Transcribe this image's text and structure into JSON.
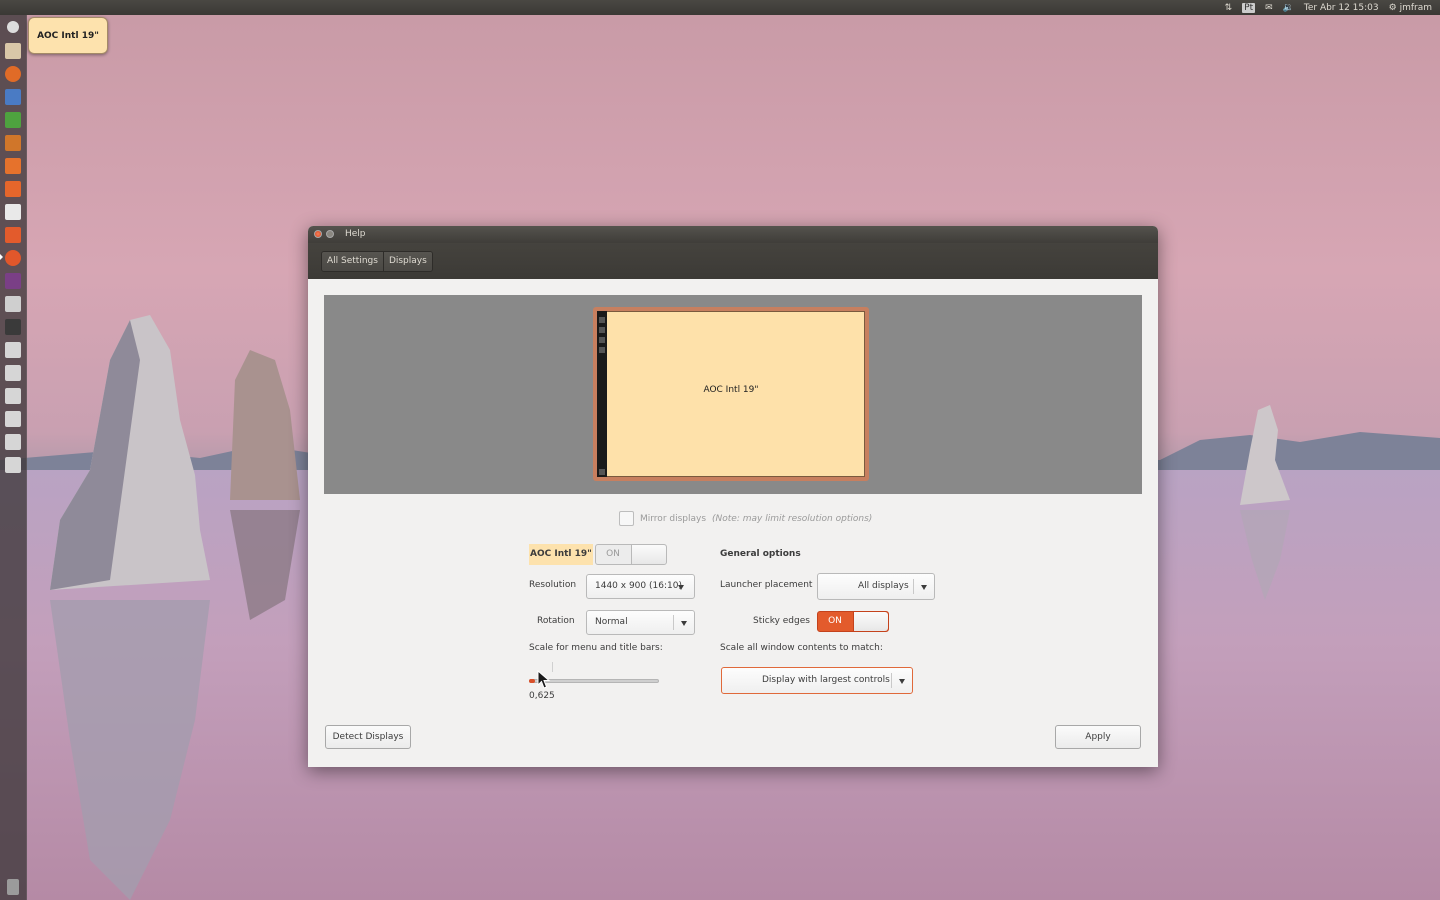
{
  "top_panel": {
    "network_icon": "network-arrows-icon",
    "keyboard_layout": "Pt",
    "mail_icon": "mail-icon",
    "sound_icon": "speaker-icon",
    "clock": "Ter Abr 12 15:03",
    "user": "jmfram"
  },
  "tooltip": {
    "text": "AOC Intl 19\""
  },
  "window": {
    "title": "Help",
    "breadcrumbs": [
      "All Settings",
      "Displays"
    ]
  },
  "preview": {
    "monitor_label": "AOC Intl 19\""
  },
  "mirror": {
    "label": "Mirror displays",
    "note": "(Note: may limit resolution options)",
    "checked": false
  },
  "display": {
    "name": "AOC Intl 19\"",
    "power_label": "ON",
    "resolution_label": "Resolution",
    "resolution_value": "1440 x 900 (16:10)",
    "rotation_label": "Rotation",
    "rotation_value": "Normal",
    "scale_label": "Scale for menu and title bars:",
    "scale_value": "0,625"
  },
  "general": {
    "heading": "General options",
    "launcher_label": "Launcher placement",
    "launcher_value": "All displays",
    "sticky_label": "Sticky edges",
    "sticky_value": "ON",
    "scale_all_label": "Scale all window contents to match:",
    "scale_all_value": "Display with largest controls"
  },
  "buttons": {
    "detect": "Detect Displays",
    "apply": "Apply"
  },
  "colors": {
    "accent": "#e35b2c",
    "highlight": "#fde2ad"
  }
}
